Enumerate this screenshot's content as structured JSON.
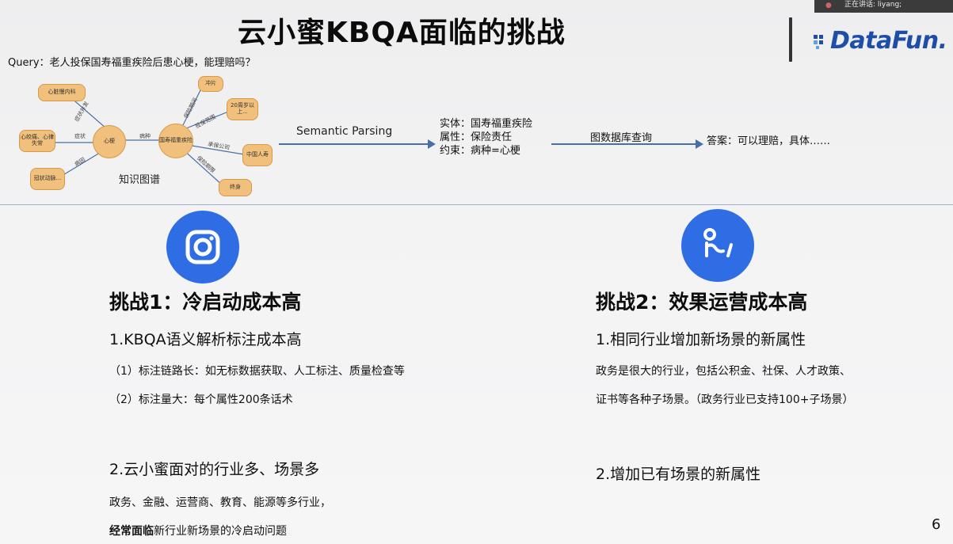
{
  "header": {
    "title": "云小蜜KBQA面临的挑战",
    "logo_text": "DataFun.",
    "speaking_indicator": "正在讲话: liyang;"
  },
  "query": "Query：老人投保国寿福重疾险后患心梗，能理赔吗？",
  "knowledge_graph": {
    "caption": "知识图谱",
    "nodes": [
      "心脏慢内科",
      "心绞痛、心律失常",
      "冠状动脉...",
      "心梗",
      "国寿福重疾险",
      "冲片",
      "20周岁以上...",
      "中国人寿",
      "终身"
    ],
    "edges": [
      "症状并发",
      "症状",
      "病因",
      "病种",
      "保险期间",
      "投保范围",
      "承保公司",
      "保险期限"
    ]
  },
  "pipeline": {
    "semantic_parsing": "Semantic Parsing",
    "entity": "实体：国寿福重疾险",
    "attribute": "属性：保险责任",
    "constraint": "约束：病种=心梗",
    "graph_db_query": "图数据库查询",
    "answer": "答案：可以理赔，具体……"
  },
  "challenge1": {
    "heading": "挑战1：冷启动成本高",
    "point1": "1.KBQA语义解析标注成本高",
    "point1_sub1": "（1）标注链路长：如无标数据获取、人工标注、质量检查等",
    "point1_sub2": "（2）标注量大：每个属性200条话术",
    "point2": "2.云小蜜面对的行业多、场景多",
    "point2_line1": "政务、金融、运营商、教育、能源等多行业，",
    "point2_line2_bold": "经常面临",
    "point2_line2_rest": "新行业新场景的冷启动问题"
  },
  "challenge2": {
    "heading": "挑战2：效果运营成本高",
    "point1": "1.相同行业增加新场景的新属性",
    "point1_line1": "政务是很大的行业，包括公积金、社保、人才政策、",
    "point1_line2": "证书等各种子场景。（政务行业已支持100+子场景）",
    "point2": "2.增加已有场景的新属性"
  },
  "page_number": "6",
  "colors": {
    "accent_blue": "#2e6de4",
    "logo_blue": "#1e4ea8",
    "node_fill": "#f1c07c",
    "divider": "#9ab2cf"
  }
}
